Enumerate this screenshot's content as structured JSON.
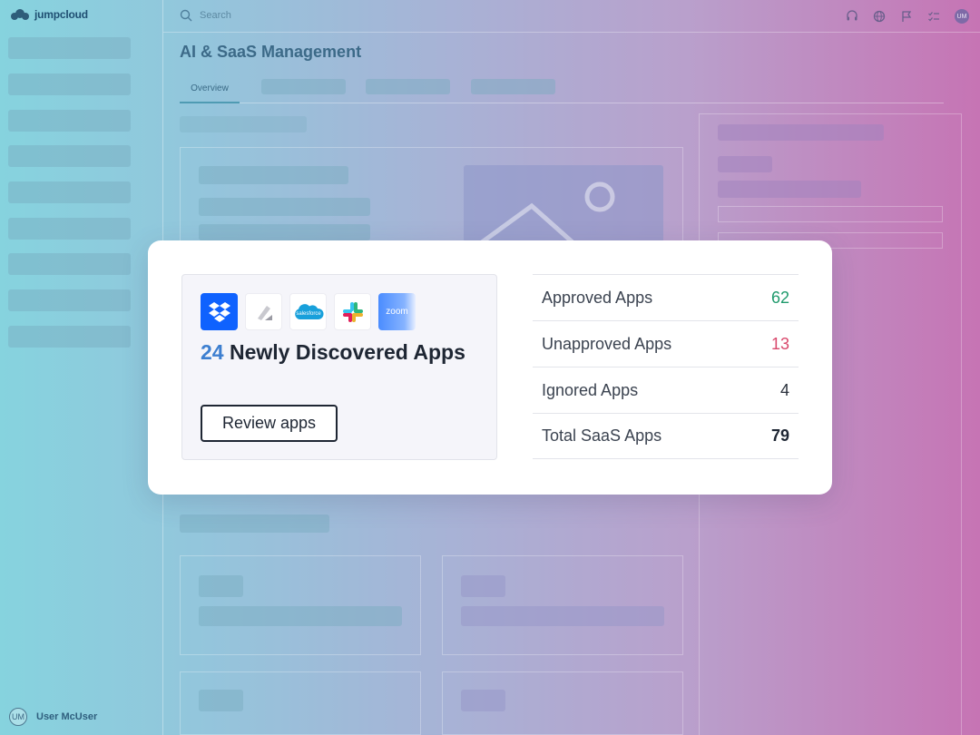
{
  "brand": {
    "name": "jumpcloud"
  },
  "search": {
    "placeholder": "Search"
  },
  "user": {
    "initials": "UM",
    "name": "User McUser"
  },
  "page": {
    "title": "AI & SaaS Management"
  },
  "tabs": [
    {
      "label": "Overview"
    }
  ],
  "discovery": {
    "count": "24",
    "label": "Newly Discovered Apps",
    "review_button": "Review apps",
    "app_logos": [
      "dropbox-logo",
      "pen-app-logo",
      "salesforce-logo",
      "slack-logo",
      "zoom-logo"
    ],
    "salesforce_text": "salesforce",
    "zoom_text": "zoom"
  },
  "stats": [
    {
      "label": "Approved Apps",
      "value": "62",
      "color": "#1f9a6c"
    },
    {
      "label": "Unapproved Apps",
      "value": "13",
      "color": "#d9486c"
    },
    {
      "label": "Ignored Apps",
      "value": "4",
      "color": "#2a313c"
    },
    {
      "label": "Total SaaS Apps",
      "value": "79",
      "color": "#1e2633"
    }
  ],
  "colors": {
    "accent": "#3d7fd0",
    "card_bg": "#ffffff"
  }
}
